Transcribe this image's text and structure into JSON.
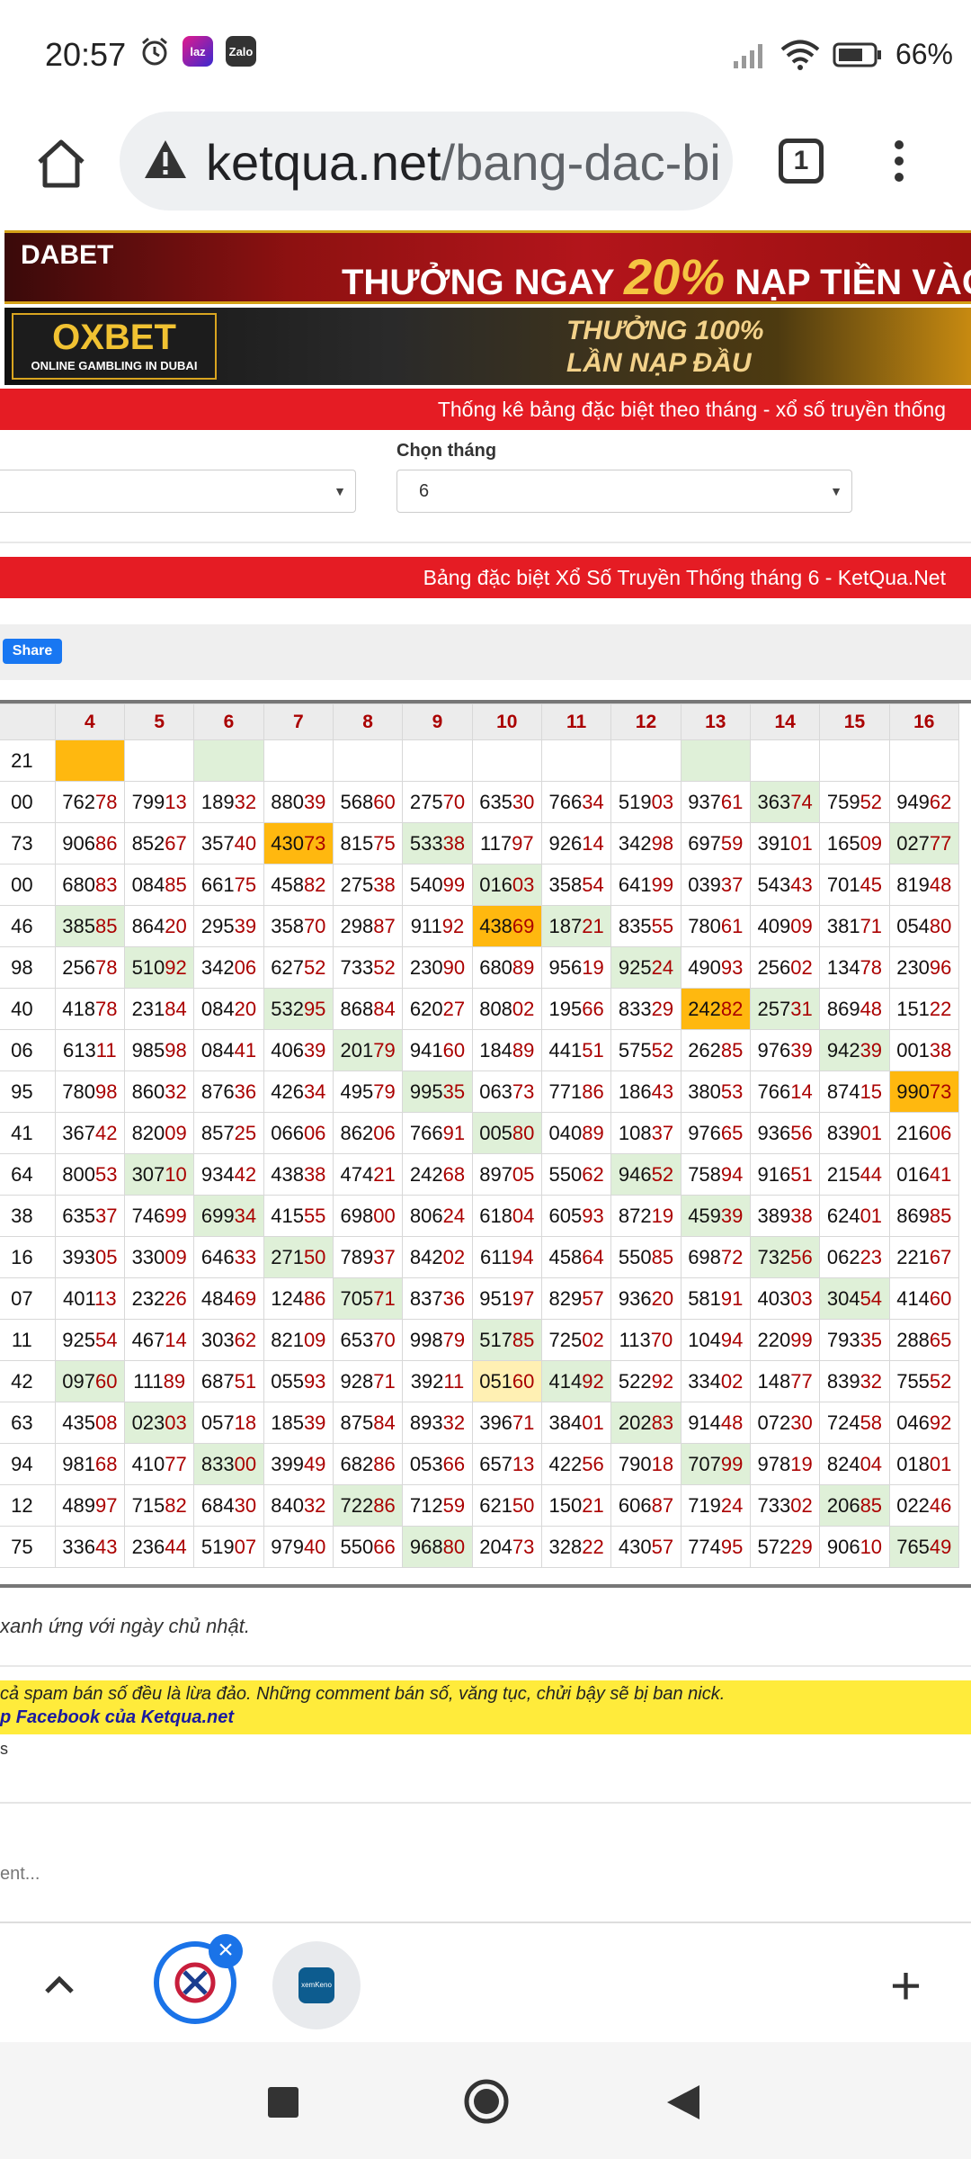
{
  "status_bar": {
    "time": "20:57",
    "app1": "laz",
    "app2": "Zalo",
    "battery": "66%"
  },
  "browser": {
    "url_host": "ketqua.net",
    "url_path": "/bang-dac-bi",
    "tab_count": "1"
  },
  "banners": {
    "b1_logo": "DABET",
    "b1_text_a": "THƯỞNG NGAY ",
    "b1_pct": "20%",
    "b1_text_b": " NẠP TIỀN VÀO THỨ",
    "b2_logo": "OXBET",
    "b2_sub": "ONLINE GAMBLING IN DUBAI",
    "b2_line1": "THƯỞNG 100%",
    "b2_line2": "LẦN NẠP ĐẦU"
  },
  "section1_title": "Thống kê bảng đặc biệt theo tháng - xổ số truyền thống",
  "month_label": "Chọn tháng",
  "month_value": "6",
  "section2_title": "Bảng đặc biệt Xổ Số Truyền Thống tháng 6 - KetQua.Net",
  "share_label": "Share",
  "table": {
    "headers": [
      "",
      "4",
      "5",
      "6",
      "7",
      "8",
      "9",
      "10",
      "11",
      "12",
      "13",
      "14",
      "15",
      "16"
    ],
    "rows": [
      [
        "21",
        "",
        "",
        "",
        "",
        "",
        "",
        "",
        "",
        "",
        "",
        "",
        "",
        ""
      ],
      [
        "00",
        "76278",
        "79913",
        "18932",
        "88039",
        "56860",
        "27570",
        "63530",
        "76634",
        "51903",
        "93761",
        "36374",
        "75952",
        "94962"
      ],
      [
        "73",
        "90686",
        "85267",
        "35740",
        "43073",
        "81575",
        "53338",
        "11797",
        "92614",
        "34298",
        "69759",
        "39101",
        "16509",
        "02777"
      ],
      [
        "00",
        "68083",
        "08485",
        "66175",
        "45882",
        "27538",
        "54099",
        "01603",
        "35854",
        "64199",
        "03937",
        "54343",
        "70145",
        "81948"
      ],
      [
        "46",
        "38585",
        "86420",
        "29539",
        "35870",
        "29887",
        "91192",
        "43869",
        "18721",
        "83555",
        "78061",
        "40909",
        "38171",
        "05480"
      ],
      [
        "98",
        "25678",
        "51092",
        "34206",
        "62752",
        "73352",
        "23090",
        "68089",
        "95619",
        "92524",
        "49093",
        "25602",
        "13478",
        "23096"
      ],
      [
        "40",
        "41878",
        "23184",
        "08420",
        "53295",
        "86884",
        "62027",
        "80802",
        "19566",
        "83329",
        "24282",
        "25731",
        "86948",
        "15122"
      ],
      [
        "06",
        "61311",
        "98598",
        "08441",
        "40639",
        "20179",
        "94160",
        "18489",
        "44151",
        "57552",
        "26285",
        "97639",
        "94239",
        "00138"
      ],
      [
        "95",
        "78098",
        "86032",
        "87636",
        "42634",
        "49579",
        "99535",
        "06373",
        "77186",
        "18643",
        "38053",
        "76614",
        "87415",
        "99073"
      ],
      [
        "41",
        "36742",
        "82009",
        "85725",
        "06606",
        "86206",
        "76691",
        "00580",
        "04089",
        "10837",
        "97665",
        "93656",
        "83901",
        "21606"
      ],
      [
        "64",
        "80053",
        "30710",
        "93442",
        "43838",
        "47421",
        "24268",
        "89705",
        "55062",
        "94652",
        "75894",
        "91651",
        "21544",
        "01641"
      ],
      [
        "38",
        "63537",
        "74699",
        "69934",
        "41555",
        "69800",
        "80624",
        "61804",
        "60593",
        "87219",
        "45939",
        "38938",
        "62401",
        "86985"
      ],
      [
        "16",
        "39305",
        "33009",
        "64633",
        "27150",
        "78937",
        "84202",
        "61194",
        "45864",
        "55085",
        "69872",
        "73256",
        "06223",
        "22167"
      ],
      [
        "07",
        "40113",
        "23226",
        "48469",
        "12486",
        "70571",
        "83736",
        "95197",
        "82957",
        "93620",
        "58191",
        "40303",
        "30454",
        "41460"
      ],
      [
        "11",
        "92554",
        "46714",
        "30362",
        "82109",
        "65370",
        "99879",
        "51785",
        "72502",
        "11370",
        "10494",
        "22099",
        "79335",
        "28865"
      ],
      [
        "42",
        "09760",
        "11189",
        "68751",
        "05593",
        "92871",
        "39211",
        "05160",
        "41492",
        "52292",
        "33402",
        "14877",
        "83932",
        "75552"
      ],
      [
        "63",
        "43508",
        "02303",
        "05718",
        "18539",
        "87584",
        "89332",
        "39671",
        "38401",
        "20283",
        "91448",
        "07230",
        "72458",
        "04692"
      ],
      [
        "94",
        "98168",
        "41077",
        "83300",
        "39949",
        "68286",
        "05366",
        "65713",
        "42256",
        "79018",
        "70799",
        "97819",
        "82404",
        "01801"
      ],
      [
        "12",
        "48997",
        "71582",
        "68430",
        "84032",
        "72286",
        "71259",
        "62150",
        "15021",
        "60687",
        "71924",
        "73302",
        "20685",
        "02246"
      ],
      [
        "75",
        "33643",
        "23644",
        "51907",
        "97940",
        "55066",
        "96880",
        "20473",
        "32822",
        "43057",
        "77495",
        "57229",
        "90610",
        "76549"
      ]
    ]
  },
  "note": "xanh ứng với ngày chủ nhật.",
  "warning_line1": "cả spam bán số đều là lừa đảo. Những comment bán số, văng tục, chửi bậy sẽ bị ban nick.",
  "warning_line2": "p Facebook của Ketqua.net",
  "comments_label": "s",
  "comment_placeholder": "ent...",
  "tab_strip": {
    "tab2_label": "xemKeno"
  }
}
